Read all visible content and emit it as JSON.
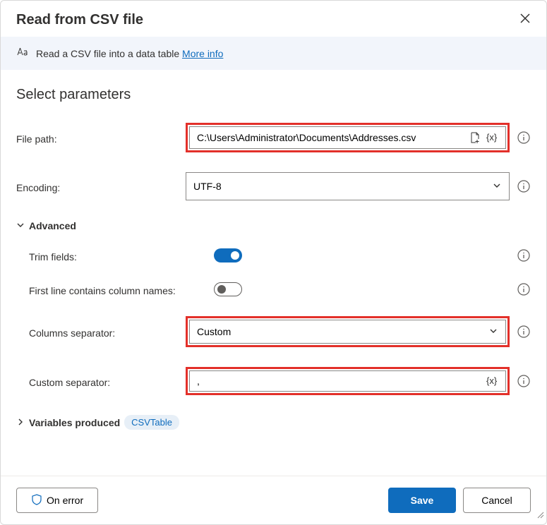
{
  "header": {
    "title": "Read from CSV file"
  },
  "banner": {
    "text": "Read a CSV file into a data table",
    "link": "More info"
  },
  "section": {
    "title": "Select parameters"
  },
  "fields": {
    "filepath": {
      "label": "File path:",
      "value": "C:\\Users\\Administrator\\Documents\\Addresses.csv"
    },
    "encoding": {
      "label": "Encoding:",
      "value": "UTF-8"
    },
    "advanced": {
      "label": "Advanced"
    },
    "trim": {
      "label": "Trim fields:"
    },
    "firstline": {
      "label": "First line contains column names:"
    },
    "separator": {
      "label": "Columns separator:",
      "value": "Custom"
    },
    "customsep": {
      "label": "Custom separator:",
      "value": ","
    },
    "variables": {
      "label": "Variables produced",
      "badge": "CSVTable"
    }
  },
  "footer": {
    "onerror": "On error",
    "save": "Save",
    "cancel": "Cancel"
  }
}
